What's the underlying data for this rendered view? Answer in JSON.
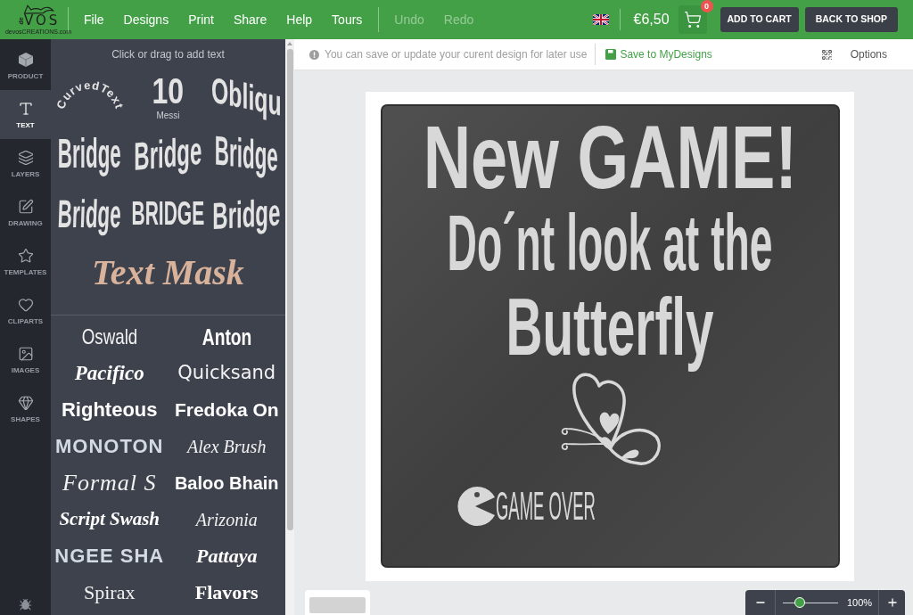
{
  "header": {
    "logo": {
      "prefix": "de",
      "name": "VOS",
      "tagline": "devosCREATIONS.com"
    },
    "menu": [
      {
        "label": "File",
        "disabled": false
      },
      {
        "label": "Designs",
        "disabled": false
      },
      {
        "label": "Print",
        "disabled": false
      },
      {
        "label": "Share",
        "disabled": false
      },
      {
        "label": "Help",
        "disabled": false
      },
      {
        "label": "Tours",
        "disabled": false
      }
    ],
    "history": [
      {
        "label": "Undo",
        "disabled": true
      },
      {
        "label": "Redo",
        "disabled": true
      }
    ],
    "price": "€6,50",
    "cart": {
      "count": "0"
    },
    "buttons": [
      "ADD TO CART",
      "BACK TO SHOP"
    ]
  },
  "sidebar": {
    "items": [
      {
        "label": "PRODUCT",
        "selected": false
      },
      {
        "label": "TEXT",
        "selected": true
      },
      {
        "label": "LAYERS",
        "selected": false
      },
      {
        "label": "DRAWING",
        "selected": false
      },
      {
        "label": "TEMPLATES",
        "selected": false
      },
      {
        "label": "CLIPARTS",
        "selected": false
      },
      {
        "label": "IMAGES",
        "selected": false
      },
      {
        "label": "SHAPES",
        "selected": false
      }
    ]
  },
  "text_panel": {
    "hint": "Click or drag to add text",
    "effects": [
      {
        "kind": "curve",
        "text": "CurvedText"
      },
      {
        "kind": "number",
        "text": "10",
        "caption": "Messi"
      },
      {
        "kind": "oblique",
        "text": "Obliqu"
      },
      {
        "kind": "arch",
        "text": "Bridge"
      },
      {
        "kind": "bulge",
        "text": "Bridge"
      },
      {
        "kind": "valley",
        "text": "Bridge"
      },
      {
        "kind": "flag",
        "text": "Bridge"
      },
      {
        "kind": "pinch",
        "text": "BRIDGE"
      },
      {
        "kind": "wave",
        "text": "Bridge"
      },
      {
        "kind": "mask",
        "text": "Text Mask"
      }
    ],
    "fonts": [
      "Oswald",
      "Anton",
      "Pacifico",
      "Quicksand",
      "Righteous",
      "Fredoka On",
      "MONOTON",
      "Alex Brush",
      "Formal S",
      "Baloo Bhain",
      "Script Swash",
      "Arizonia",
      "NGEE SHA",
      "Pattaya",
      "Spirax",
      "Flavors"
    ]
  },
  "toolbar": {
    "notice": "You can save or update your curent design for later use",
    "save_link": "Save to MyDesigns",
    "options": "Options"
  },
  "design": {
    "lines": [
      "New GAME!",
      "Do´nt look at the",
      "Butterfly"
    ],
    "badge": "GAME OVER"
  },
  "zoom": {
    "level": 0.3,
    "reading": "100%"
  }
}
